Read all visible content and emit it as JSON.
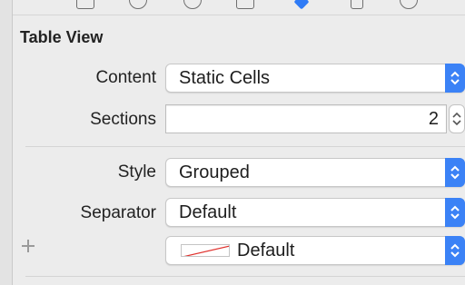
{
  "section": {
    "title": "Table View"
  },
  "content": {
    "label": "Content",
    "value": "Static Cells"
  },
  "sections": {
    "label": "Sections",
    "value": "2"
  },
  "style": {
    "label": "Style",
    "value": "Grouped"
  },
  "separator": {
    "label": "Separator",
    "value": "Default"
  },
  "separator_color": {
    "value": "Default",
    "swatch_line_color": "#e0312d"
  },
  "colors": {
    "accent": "#3b82f6"
  },
  "icons": [
    "file-icon",
    "circle-icon",
    "info-icon",
    "ruler-icon",
    "attributes-icon",
    "size-icon",
    "connections-icon",
    "stepper-icon",
    "chevron-updown-icon",
    "plus-icon"
  ]
}
